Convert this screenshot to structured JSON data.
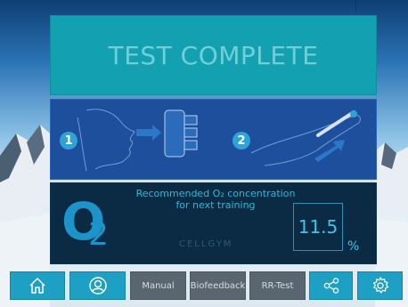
{
  "title_panel": {
    "title": "TEST COMPLETE"
  },
  "instructions": {
    "step1_number": "1",
    "step2_number": "2"
  },
  "result": {
    "o2_symbol": "O",
    "o2_subscript": "2",
    "recommendation_line1": "Recommended O₂ concentration",
    "recommendation_line2": "for next training",
    "value": "11.5",
    "unit": "%",
    "brand": "CELLGYM"
  },
  "toolbar": {
    "home_icon": "home-icon",
    "user_icon": "user-icon",
    "manual_label": "Manual",
    "biofeedback_label": "Biofeedback",
    "rrtest_label": "RR-Test",
    "share_icon": "share-icon",
    "settings_icon": "gear-icon"
  },
  "colors": {
    "title_panel": "#13a0b0",
    "instruction_panel": "#1e4f9c",
    "result_panel": "#0b2a43",
    "icon_button": "#1ea0c4",
    "text_button": "#59666f"
  }
}
